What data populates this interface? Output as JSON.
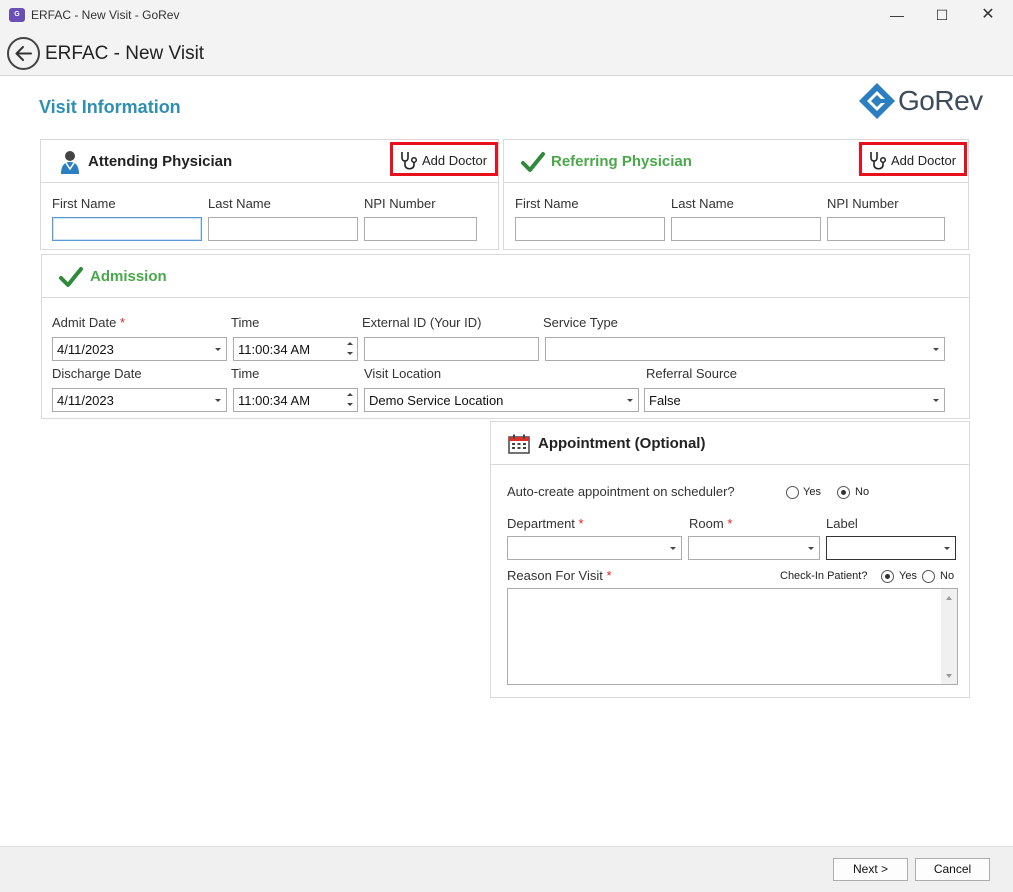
{
  "window": {
    "title": "ERFAC - New Visit - GoRev",
    "app_icon_text": "GoRev"
  },
  "header": {
    "title": "ERFAC - New Visit"
  },
  "section": {
    "title": "Visit Information"
  },
  "logo": {
    "text": "GoRev",
    "colors": [
      "#2b7fc1",
      "#3d4c5c"
    ]
  },
  "attending": {
    "title": "Attending Physician",
    "add_doctor": "Add Doctor",
    "first_name_label": "First Name",
    "last_name_label": "Last Name",
    "npi_label": "NPI Number",
    "first_name_value": "",
    "last_name_value": "",
    "npi_value": ""
  },
  "referring": {
    "title": "Referring Physician",
    "add_doctor": "Add Doctor",
    "first_name_label": "First Name",
    "last_name_label": "Last Name",
    "npi_label": "NPI Number",
    "first_name_value": "",
    "last_name_value": "",
    "npi_value": ""
  },
  "admission": {
    "title": "Admission",
    "admit_date_label": "Admit Date",
    "admit_date": "4/11/2023",
    "admit_time_label": "Time",
    "admit_time": "11:00:34 AM",
    "external_id_label": "External ID (Your ID)",
    "external_id": "",
    "service_type_label": "Service Type",
    "service_type": "",
    "discharge_date_label": "Discharge Date",
    "discharge_date": "4/11/2023",
    "discharge_time_label": "Time",
    "discharge_time": "11:00:34 AM",
    "visit_location_label": "Visit Location",
    "visit_location": "Demo Service Location",
    "referral_source_label": "Referral Source",
    "referral_source": "False"
  },
  "appointment": {
    "title": "Appointment (Optional)",
    "auto_create_label": "Auto-create appointment on scheduler?",
    "yes": "Yes",
    "no": "No",
    "department_label": "Department",
    "room_label": "Room",
    "label_label": "Label",
    "reason_label": "Reason For Visit",
    "checkin_label": "Check-In Patient?",
    "checkin_yes": "Yes",
    "checkin_no": "No"
  },
  "required_marker": "*",
  "footer": {
    "next": "Next >",
    "cancel": "Cancel"
  },
  "colors": {
    "accent": "#2e8fb4",
    "green": "#4aa84a",
    "highlight": "#e8101c",
    "required": "#e02020"
  }
}
